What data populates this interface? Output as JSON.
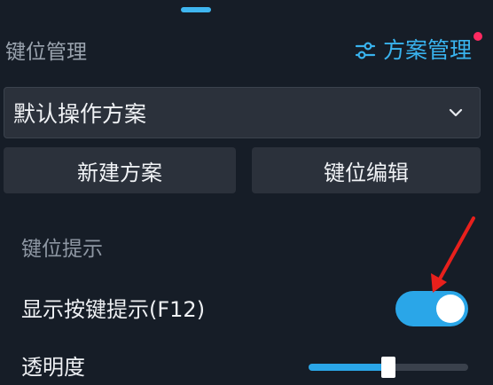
{
  "header": {
    "title": "键位管理",
    "scheme_link_label": "方案管理",
    "scheme_link_icon": "sliders-icon",
    "notification_color": "#ff2a61"
  },
  "scheme_select": {
    "selected": "默认操作方案",
    "icon": "chevron-down-icon"
  },
  "buttons": {
    "new_scheme": "新建方案",
    "edit_keys": "键位编辑"
  },
  "key_hint": {
    "section_title": "键位提示",
    "show_hint_label": "显示按键提示(F12)",
    "show_hint_on": true,
    "opacity_label": "透明度",
    "opacity_value": 0.5
  },
  "colors": {
    "accent": "#2aa6e8",
    "annotation_arrow": "#e8201c"
  }
}
